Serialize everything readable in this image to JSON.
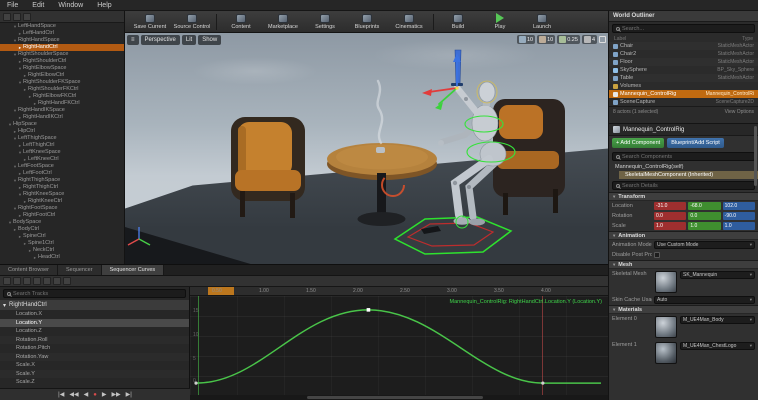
{
  "menu": {
    "items": [
      "File",
      "Edit",
      "Window",
      "Help"
    ]
  },
  "rig": {
    "items": [
      "LeftHandSpace",
      "LeftHandCtrl",
      "RightHandSpace",
      "RightHandCtrl",
      "RightShoulderSpace",
      "RightShoulderCtrl",
      "RightElbowSpace",
      "RightElbowCtrl",
      "RightShoulderFKSpace",
      "RightShoulderFKCtrl",
      "RightElbowFKCtrl",
      "RightHandFKCtrl",
      "RightHandIKSpace",
      "RightHandIKCtrl",
      "HipSpace",
      "HipCtrl",
      "LeftThighSpace",
      "LeftThighCtrl",
      "LeftKneeSpace",
      "LeftKneeCtrl",
      "LeftFootSpace",
      "LeftFootCtrl",
      "RightThighSpace",
      "RightThighCtrl",
      "RightKneeSpace",
      "RightKneeCtrl",
      "RightFootSpace",
      "RightFootCtrl",
      "BodySpace",
      "BodyCtrl",
      "SpineCtrl",
      "Spine1Ctrl",
      "NeckCtrl",
      "HeadCtrl"
    ]
  },
  "toolbar": {
    "buttons": [
      "Save Current",
      "Source Control",
      "Content",
      "Marketplace",
      "Settings",
      "Blueprints",
      "Cinematics",
      "Build",
      "Play",
      "Launch"
    ]
  },
  "viewport": {
    "perspective": "Perspective",
    "lit": "Lit",
    "show": "Show",
    "grid_snap": "10",
    "angle_snap": "10",
    "scale_snap": "0.25",
    "camera_speed": "4"
  },
  "outliner": {
    "title": "World Outliner",
    "search_placeholder": "Search...",
    "col_label": "Label",
    "col_type": "Type",
    "rows": [
      {
        "label": "Chair",
        "type": "StaticMeshActor"
      },
      {
        "label": "Chair2",
        "type": "StaticMeshActor"
      },
      {
        "label": "Floor",
        "type": "StaticMeshActor"
      },
      {
        "label": "SkySphere",
        "type": "BP_Sky_Sphere"
      },
      {
        "label": "Table",
        "type": "StaticMeshActor"
      },
      {
        "label": "Volumes",
        "type": ""
      },
      {
        "label": "Mannequin_ControlRig",
        "type": "Mannequin_ControlRi"
      },
      {
        "label": "SceneCapture",
        "type": "SceneCapture2D"
      }
    ],
    "footer": "8 actors (1 selected)",
    "view_options": "View Options"
  },
  "details": {
    "actor_name": "Mannequin_ControlRig",
    "add_component": "+ Add Component",
    "add_script": "Blueprint/Add Script",
    "search_components_placeholder": "Search Components",
    "components": [
      "Mannequin_ControlRig(self)",
      "SkeletalMeshComponent (Inherited)"
    ],
    "search_placeholder": "Search Details",
    "transform_section": "Transform",
    "transform": [
      {
        "label": "Location",
        "x": "-31.0",
        "y": "-68.0",
        "z": "102.0"
      },
      {
        "label": "Rotation",
        "x": "0.0",
        "y": "0.0",
        "z": "-90.0"
      },
      {
        "label": "Scale",
        "x": "1.0",
        "y": "1.0",
        "z": "1.0"
      }
    ],
    "animation_section": "Animation",
    "animation_mode_label": "Animation Mode",
    "animation_mode_value": "Use Custom Mode",
    "post_process_label": "Disable Post Process Bl",
    "mesh_section": "Mesh",
    "skeletal_mesh_label": "Skeletal Mesh",
    "skeletal_mesh_value": "SK_Mannequin",
    "skin_cache_label": "Skin Cache Usage",
    "skin_cache_value": "Auto",
    "materials_section": "Materials",
    "materials": [
      {
        "label": "Element 0",
        "value": "M_UE4Man_Body"
      },
      {
        "label": "Element 1",
        "value": "M_UE4Man_ChestLogo"
      }
    ]
  },
  "sequencer": {
    "tabs": [
      "Content Browser",
      "Sequencer",
      "Sequencer Curves"
    ],
    "search_placeholder": "Search Tracks",
    "group": "RightHandCtrl",
    "tracks": [
      "Location.X",
      "Location.Y",
      "Location.Z",
      "Rotation.Roll",
      "Rotation.Pitch",
      "Rotation.Yaw",
      "Scale.X",
      "Scale.Y",
      "Scale.Z"
    ],
    "selected_track": "Location.Y",
    "ruler": [
      "0.50",
      "1.00",
      "1.50",
      "2.00",
      "2.50",
      "3.00",
      "3.50",
      "4.00"
    ],
    "y_ticks": [
      "15",
      "10",
      "5",
      "0"
    ],
    "curve_label": "Mannequin_ControlRig: RightHandCtrl.Location.Y (Location.Y)",
    "curve_keys": [
      {
        "time": "0.00",
        "value": "0"
      },
      {
        "time": "1.75",
        "value": "15"
      },
      {
        "time": "3.50",
        "value": "0"
      }
    ],
    "transport": [
      "|◀",
      "◀◀",
      "◀",
      "●",
      "▶",
      "▶▶",
      "▶|"
    ]
  }
}
